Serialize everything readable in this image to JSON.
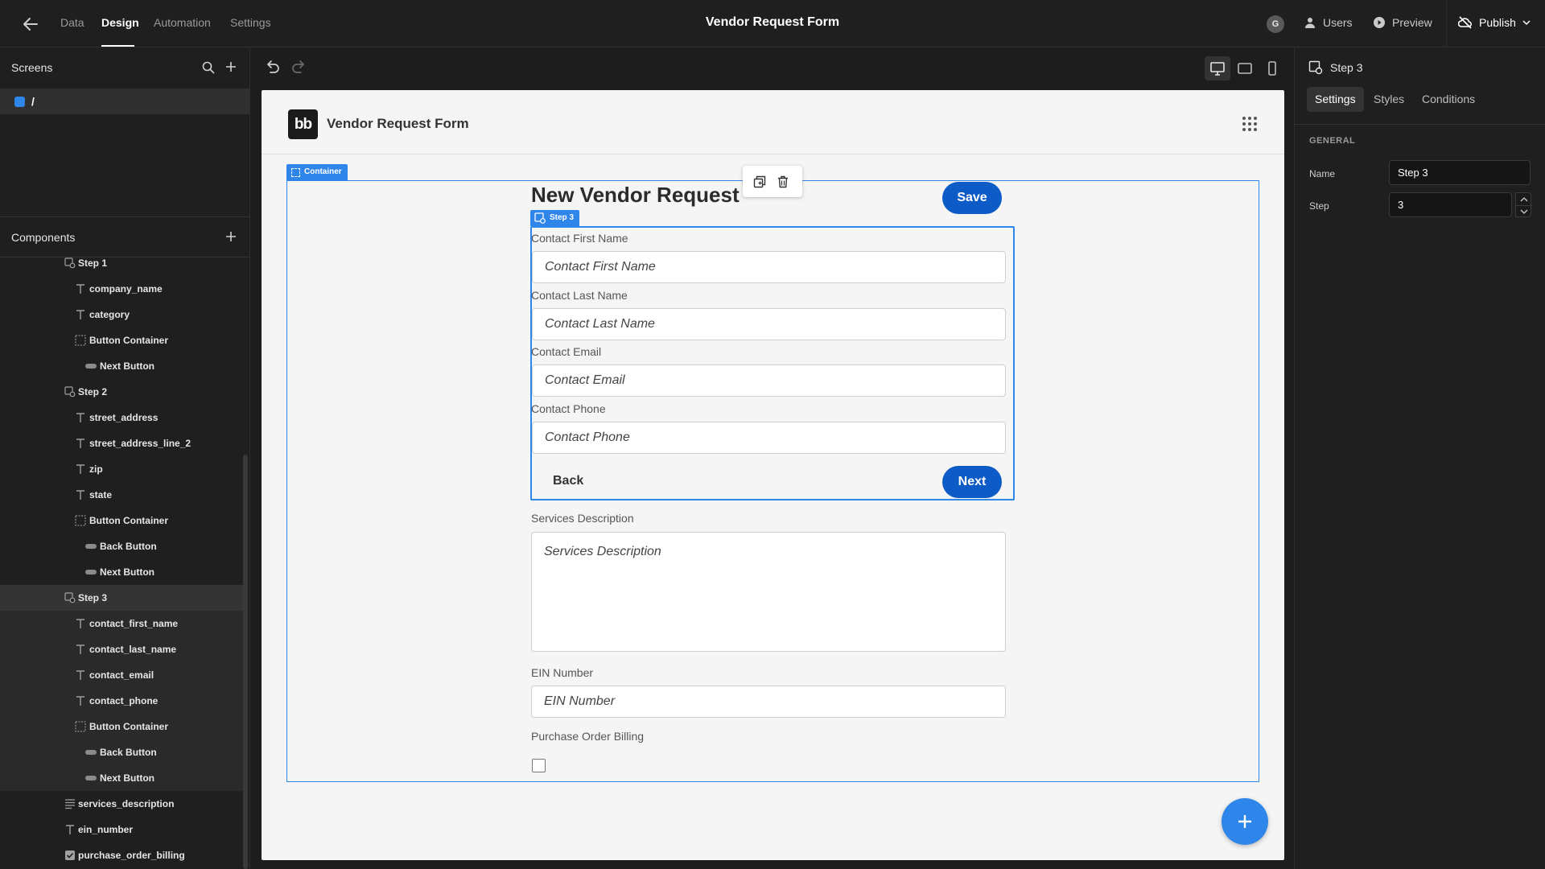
{
  "topbar": {
    "tabs": [
      "Data",
      "Design",
      "Automation",
      "Settings"
    ],
    "active_tab": "Design",
    "title": "Vendor Request Form",
    "avatar_initial": "G",
    "users_label": "Users",
    "preview_label": "Preview",
    "publish_label": "Publish"
  },
  "left": {
    "screens_title": "Screens",
    "screen_route": "/",
    "components_title": "Components",
    "tree": [
      {
        "label": "Step 1",
        "icon": "step-icon",
        "level": 1
      },
      {
        "label": "company_name",
        "icon": "text-field-icon",
        "level": 2
      },
      {
        "label": "category",
        "icon": "text-field-icon",
        "level": 2
      },
      {
        "label": "Button Container",
        "icon": "container-icon",
        "level": 2
      },
      {
        "label": "Next Button",
        "icon": "button-icon",
        "level": 3
      },
      {
        "label": "Step 2",
        "icon": "step-icon",
        "level": 1
      },
      {
        "label": "street_address",
        "icon": "text-field-icon",
        "level": 2
      },
      {
        "label": "street_address_line_2",
        "icon": "text-field-icon",
        "level": 2
      },
      {
        "label": "zip",
        "icon": "text-field-icon",
        "level": 2
      },
      {
        "label": "state",
        "icon": "text-field-icon",
        "level": 2
      },
      {
        "label": "Button Container",
        "icon": "container-icon",
        "level": 2
      },
      {
        "label": "Back Button",
        "icon": "button-icon",
        "level": 3
      },
      {
        "label": "Next Button",
        "icon": "button-icon",
        "level": 3
      },
      {
        "label": "Step 3",
        "icon": "step-icon",
        "level": 1,
        "selected": true
      },
      {
        "label": "contact_first_name",
        "icon": "text-field-icon",
        "level": 2
      },
      {
        "label": "contact_last_name",
        "icon": "text-field-icon",
        "level": 2
      },
      {
        "label": "contact_email",
        "icon": "text-field-icon",
        "level": 2
      },
      {
        "label": "contact_phone",
        "icon": "text-field-icon",
        "level": 2
      },
      {
        "label": "Button Container",
        "icon": "container-icon",
        "level": 2
      },
      {
        "label": "Back Button",
        "icon": "button-icon",
        "level": 3
      },
      {
        "label": "Next Button",
        "icon": "button-icon",
        "level": 3
      },
      {
        "label": "services_description",
        "icon": "long-text-icon",
        "level": 1
      },
      {
        "label": "ein_number",
        "icon": "text-field-icon",
        "level": 1
      },
      {
        "label": "purchase_order_billing",
        "icon": "checkbox-icon",
        "level": 1
      }
    ]
  },
  "canvas": {
    "app_title": "Vendor Request Form",
    "logo_text": "bb",
    "container_tag": "Container",
    "step_tag": "Step 3",
    "form_title": "New Vendor Request",
    "save_label": "Save",
    "fields": [
      {
        "label": "Contact First Name",
        "placeholder": "Contact First Name"
      },
      {
        "label": "Contact Last Name",
        "placeholder": "Contact Last Name"
      },
      {
        "label": "Contact Email",
        "placeholder": "Contact Email"
      },
      {
        "label": "Contact Phone",
        "placeholder": "Contact Phone"
      }
    ],
    "back_label": "Back",
    "next_label": "Next",
    "services": {
      "label": "Services Description",
      "placeholder": "Services Description"
    },
    "ein": {
      "label": "EIN Number",
      "placeholder": "EIN Number"
    },
    "po": {
      "label": "Purchase Order Billing"
    }
  },
  "right": {
    "component_name": "Step 3",
    "tabs": [
      "Settings",
      "Styles",
      "Conditions"
    ],
    "active_tab": "Settings",
    "section": "GENERAL",
    "name_label": "Name",
    "name_value": "Step 3",
    "step_label": "Step",
    "step_value": "3"
  },
  "colors": {
    "accent": "#2f86ea",
    "button": "#0d5bc6",
    "dark_bg": "#1f1f1f"
  }
}
